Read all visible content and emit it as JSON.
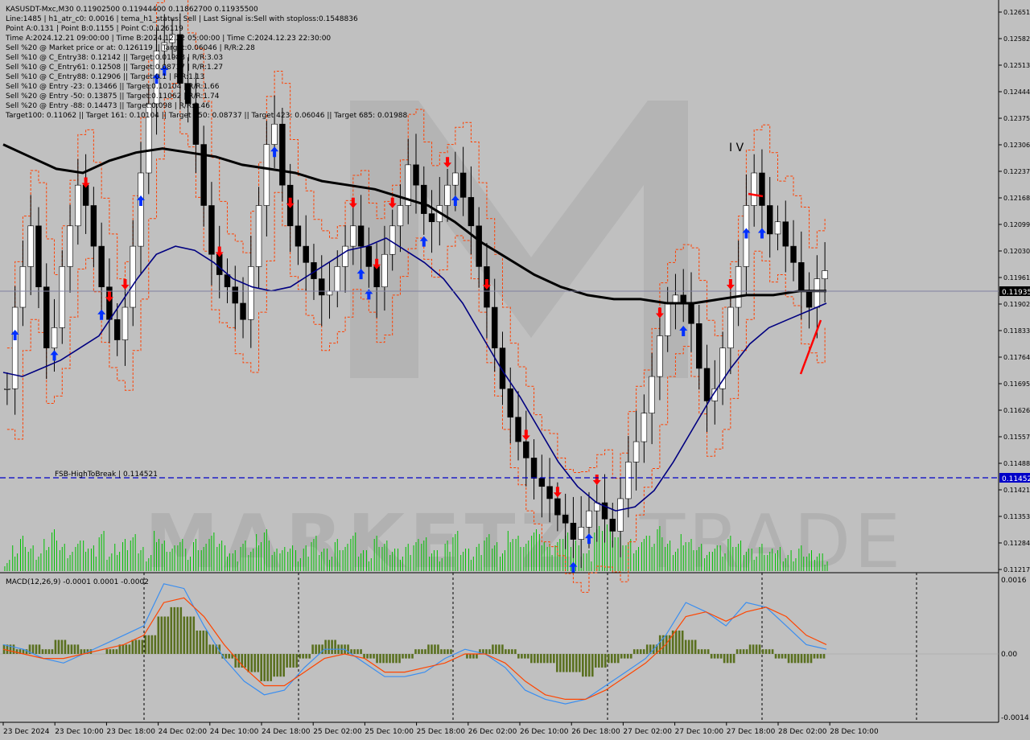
{
  "header": {
    "symbol_line": "KASUSDT-Mxc,M30  0.11902500 0.11944400 0.11862700 0.11935500",
    "info_lines": [
      "Line:1485 | h1_atr_c0: 0.0016 | tema_h1_status: Sell | Last Signal is:Sell with stoploss:0.1548836",
      "Point A:0.131 | Point B:0.1155 | Point C:0.126119",
      "Time A:2024.12.21 09:00:00 | Time B:2024.12.22 05:00:00 | Time C:2024.12.23 22:30:00",
      "Sell %20 @ Market price or at: 0.126119 || Target:0.06046 | R/R:2.28",
      "Sell %10 @ C_Entry38: 0.12142 || Target:0.01988 | R/R:3.03",
      "Sell %10 @ C_Entry61: 0.12508 || Target:0.08737 | R/R:1.27",
      "Sell %10 @ C_Entry88: 0.12906 || Target:0.1 | R/R:1.13",
      "Sell %10 @ Entry -23: 0.13466 || Target:0.10104 | R/R:1.66",
      "Sell %20 @ Entry -50: 0.13875 || Target:0.11062 | R/R:1.74",
      "Sell %20 @ Entry -88: 0.14473 || Target:0.098 | R/R:3.46",
      "Target100: 0.11062 || Target 161: 0.10104 || Target 250: 0.08737 || Target 423: 0.06046 || Target 685: 0.01988"
    ]
  },
  "annotations": {
    "wave_label": "I V",
    "fsb_label": "FSB-HighToBreak | 0.114521",
    "current_price": "0.11935",
    "fsb_price": "0.11452"
  },
  "watermark": {
    "main": "MARKETZ",
    "suffix": "TRADE"
  },
  "macd": {
    "label": "MACD(12,26,9) -0.0001 0.0001 -0.0002",
    "axis_labels": [
      "0.0016",
      "0.00",
      "-0.0014"
    ]
  },
  "colors": {
    "background": "#c0c0c0",
    "bull_candle": "#ffffff",
    "bear_candle": "#000000",
    "ma_fast": "#000080",
    "ma_slow": "#000000",
    "envelope": "#ff4000",
    "volume": "#00c000",
    "macd_hist": "#5a7020",
    "macd_main": "#3a8ef0",
    "macd_signal": "#ff4500",
    "fsb_line": "#0000c8",
    "buy_arrow": "#0030ff",
    "sell_arrow": "#ff0000"
  },
  "chart_data": {
    "type": "line",
    "title": "KASUSDT-Mxc,M30",
    "price_axis": {
      "ylim": [
        0.1121,
        0.12585
      ],
      "ticks": [
        "0.12651",
        "0.12582",
        "0.12513",
        "0.12444",
        "0.12375",
        "0.12306",
        "0.12237",
        "0.12168",
        "0.12099",
        "0.12030",
        "0.11961",
        "0.11902",
        "0.11833",
        "0.11764",
        "0.11695",
        "0.11626",
        "0.11557",
        "0.11488",
        "0.11421",
        "0.11353",
        "0.11284",
        "0.11217"
      ]
    },
    "time_axis": {
      "labels": [
        "23 Dec 2024",
        "23 Dec 10:00",
        "23 Dec 18:00",
        "24 Dec 02:00",
        "24 Dec 10:00",
        "24 Dec 18:00",
        "25 Dec 02:00",
        "25 Dec 10:00",
        "25 Dec 18:00",
        "26 Dec 02:00",
        "26 Dec 10:00",
        "26 Dec 18:00",
        "27 Dec 02:00",
        "27 Dec 10:00",
        "27 Dec 18:00",
        "28 Dec 02:00",
        "28 Dec 10:00"
      ]
    },
    "series": [
      {
        "name": "",
        "values": [
          0.1165,
          0.1185,
          0.1195,
          0.1205,
          0.119,
          0.1175,
          0.118,
          0.1195,
          0.1205,
          0.1215,
          0.121,
          0.12,
          0.119,
          0.1182,
          0.1177,
          0.1185,
          0.12,
          0.1218,
          0.1235,
          0.1248,
          0.125,
          0.1252,
          0.124,
          0.1235,
          0.1225,
          0.121,
          0.1198,
          0.1193,
          0.119,
          0.1186,
          0.1182,
          0.1195,
          0.121,
          0.1225,
          0.123,
          0.1215,
          0.1205,
          0.12,
          0.1196,
          0.1192,
          0.1188,
          0.1189,
          0.1195,
          0.12,
          0.1205,
          0.12,
          0.1195,
          0.119,
          0.1198,
          0.1205,
          0.121,
          0.122,
          0.1215,
          0.1208,
          0.1206,
          0.121,
          0.1215,
          0.1218,
          0.1212,
          0.1205,
          0.1195,
          0.1185,
          0.1175,
          0.1165,
          0.1158,
          0.1152,
          0.1148,
          0.1143,
          0.1141,
          0.1138,
          0.1134,
          0.1132,
          0.1128,
          0.1131,
          0.1135,
          0.1137,
          0.1133,
          0.113,
          0.1138,
          0.1147,
          0.1152,
          0.1159,
          0.1168,
          0.1178,
          0.1186,
          0.1188,
          0.1186,
          0.1181,
          0.117,
          0.1162,
          0.1165,
          0.1175,
          0.1185,
          0.1195,
          0.121,
          0.1218,
          0.121,
          0.1203,
          0.1206,
          0.12,
          0.1196,
          0.1189,
          0.1185,
          0.1192,
          0.1194
        ]
      },
      {
        "name": "",
        "values": [
          0.1169,
          0.1168,
          0.117,
          0.1172,
          0.1175,
          0.1178,
          0.1185,
          0.1192,
          0.1198,
          0.12,
          0.1199,
          0.1196,
          0.1192,
          0.119,
          0.1189,
          0.119,
          0.1193,
          0.1196,
          0.1199,
          0.12,
          0.1202,
          0.1199,
          0.1196,
          0.1192,
          0.1186,
          0.1178,
          0.117,
          0.1163,
          0.1155,
          0.1147,
          0.1141,
          0.1137,
          0.1135,
          0.1136,
          0.114,
          0.1147,
          0.1155,
          0.1163,
          0.117,
          0.1176,
          0.118,
          0.1182,
          0.1184,
          0.1186
        ]
      },
      {
        "name": "",
        "values": [
          0.1225,
          0.1222,
          0.1219,
          0.1218,
          0.1221,
          0.1223,
          0.1224,
          0.1223,
          0.1222,
          0.122,
          0.1219,
          0.1218,
          0.1216,
          0.1215,
          0.1214,
          0.1212,
          0.121,
          0.1206,
          0.1201,
          0.1197,
          0.1193,
          0.119,
          0.1188,
          0.1187,
          0.1187,
          0.1186,
          0.1186,
          0.1187,
          0.1188,
          0.1188,
          0.1189,
          0.1189
        ]
      }
    ],
    "volume": [
      1,
      3,
      5,
      3,
      2,
      4,
      6,
      3,
      2,
      5,
      4,
      3,
      6,
      2,
      3,
      4,
      5,
      3,
      2,
      6,
      4,
      3,
      5,
      2,
      4,
      3,
      6,
      5,
      3,
      2,
      4,
      3,
      5,
      6,
      2,
      3,
      4,
      2,
      3,
      5,
      3,
      2,
      4,
      3,
      6,
      3,
      2,
      5,
      4,
      3,
      2,
      3,
      4,
      5,
      3,
      2,
      4,
      6,
      3,
      2,
      3,
      5,
      4,
      3,
      6,
      5,
      4,
      7,
      5,
      3,
      4,
      6,
      5,
      3,
      2,
      7,
      8,
      6,
      5,
      4,
      3,
      6,
      5,
      7,
      4,
      3,
      5,
      4,
      3,
      2,
      4,
      3,
      5,
      4,
      3,
      2,
      3,
      2,
      3,
      2,
      2,
      3,
      2,
      2,
      1
    ],
    "macd": {
      "histogram": [
        0.0002,
        0.0001,
        0.0002,
        0.0001,
        0.0003,
        0.0002,
        0.0001,
        0.0,
        0.0001,
        0.0002,
        0.0003,
        0.0004,
        0.0008,
        0.001,
        0.0008,
        0.0005,
        0.0002,
        -0.0001,
        -0.0003,
        -0.0004,
        -0.0006,
        -0.0005,
        -0.0003,
        -0.0001,
        0.0002,
        0.0003,
        0.0002,
        0.0001,
        -0.0001,
        -0.0002,
        -0.0002,
        -0.0001,
        0.0001,
        0.0002,
        0.0001,
        0.0,
        -0.0001,
        0.0001,
        0.0002,
        0.0001,
        -0.0001,
        -0.0002,
        -0.0002,
        -0.0004,
        -0.0004,
        -0.0005,
        -0.0003,
        -0.0002,
        -0.0001,
        0.0001,
        0.0002,
        0.0004,
        0.0005,
        0.0003,
        0.0001,
        -0.0001,
        -0.0002,
        0.0001,
        0.0002,
        0.0001,
        -0.0001,
        -0.0002,
        -0.0002,
        -0.0001
      ],
      "main": [
        0.0002,
        0.0001,
        -0.0001,
        -0.0002,
        0.0,
        0.0002,
        0.0004,
        0.0006,
        0.0015,
        0.0014,
        0.0006,
        -0.0001,
        -0.0006,
        -0.0009,
        -0.0008,
        -0.0003,
        0.0001,
        0.0001,
        -0.0002,
        -0.0005,
        -0.0005,
        -0.0004,
        -0.0001,
        0.0001,
        0.0,
        -0.0003,
        -0.0008,
        -0.001,
        -0.0011,
        -0.001,
        -0.0007,
        -0.0004,
        -0.0001,
        0.0004,
        0.0011,
        0.0009,
        0.0006,
        0.0011,
        0.001,
        0.0006,
        0.0002,
        0.0001
      ],
      "signal": [
        0.0001,
        0.0,
        -0.0001,
        -0.0001,
        0.0,
        0.0001,
        0.0002,
        0.0004,
        0.0011,
        0.0012,
        0.0008,
        0.0002,
        -0.0003,
        -0.0007,
        -0.0007,
        -0.0004,
        -0.0001,
        0.0,
        -0.0001,
        -0.0004,
        -0.0004,
        -0.0003,
        -0.0002,
        0.0,
        0.0,
        -0.0002,
        -0.0006,
        -0.0009,
        -0.001,
        -0.001,
        -0.0008,
        -0.0005,
        -0.0002,
        0.0002,
        0.0008,
        0.0009,
        0.0007,
        0.0009,
        0.001,
        0.0008,
        0.0004,
        0.0002
      ]
    }
  }
}
